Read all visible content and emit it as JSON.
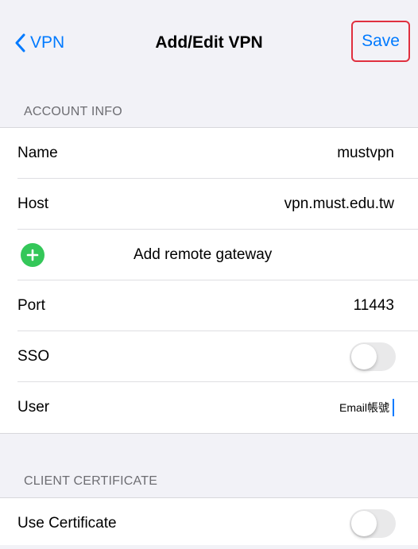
{
  "nav": {
    "back_label": "VPN",
    "title": "Add/Edit VPN",
    "save_label": "Save"
  },
  "account_info": {
    "header": "ACCOUNT INFO",
    "name": {
      "label": "Name",
      "value": "mustvpn"
    },
    "host": {
      "label": "Host",
      "value": "vpn.must.edu.tw"
    },
    "add_gateway": {
      "label": "Add remote gateway",
      "icon": "plus-circle-icon"
    },
    "port": {
      "label": "Port",
      "value": "11443"
    },
    "sso": {
      "label": "SSO",
      "enabled": false
    },
    "user": {
      "label": "User",
      "value": "Email帳號"
    }
  },
  "client_certificate": {
    "header": "CLIENT CERTIFICATE",
    "use_certificate": {
      "label": "Use Certificate",
      "enabled": false
    }
  },
  "colors": {
    "accent": "#007aff",
    "highlight_box": "#e0303f",
    "add_icon": "#34c759",
    "background": "#f2f2f7"
  }
}
